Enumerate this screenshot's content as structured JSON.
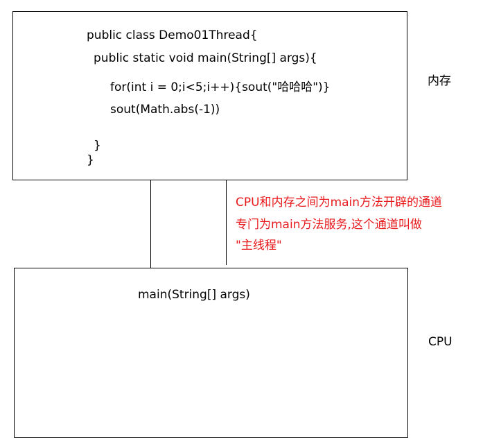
{
  "memory_box": {
    "code_lines": [
      "public class Demo01Thread{",
      "public static void main(String[] args){",
      "for(int i = 0;i<5;i++){sout(\"哈哈哈\")}",
      "sout(Math.abs(-1))",
      "}",
      "}"
    ],
    "label": "内存"
  },
  "cpu_box": {
    "content": "main(String[] args)",
    "label": "CPU"
  },
  "annotation": {
    "lines": [
      "CPU和内存之间为main方法开辟的通道",
      "专门为main方法服务,这个通道叫做",
      "\"主线程\""
    ],
    "color": "#e8191c"
  }
}
